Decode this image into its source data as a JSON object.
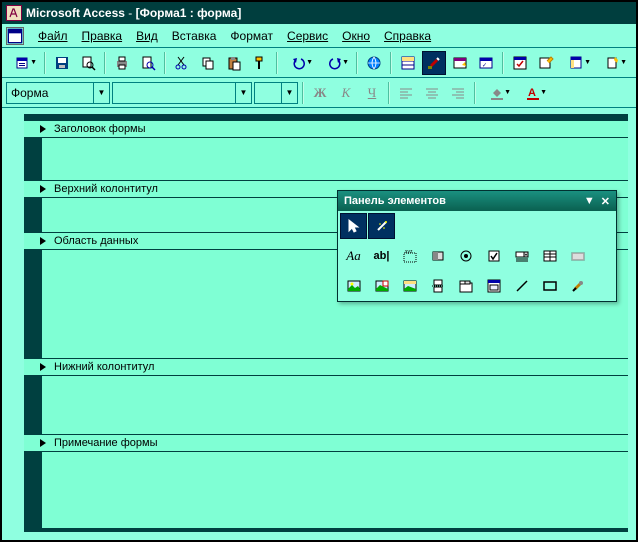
{
  "title": {
    "app": "Microsoft Access",
    "doc": "[Форма1 : форма]"
  },
  "menu": [
    "Файл",
    "Правка",
    "Вид",
    "Вставка",
    "Формат",
    "Сервис",
    "Окно",
    "Справка"
  ],
  "menu_accel": [
    0,
    0,
    0,
    1,
    3,
    0,
    0,
    0
  ],
  "format": {
    "object": "Форма",
    "bold": "Ж",
    "italic": "К",
    "underline": "Ч"
  },
  "sections": [
    "Заголовок формы",
    "Верхний колонтитул",
    "Область данных",
    "Нижний колонтитул",
    "Примечание формы"
  ],
  "toolbox": {
    "title": "Панель элементов"
  },
  "icons": {
    "view": "view-icon",
    "save": "save-icon",
    "search": "search-icon",
    "print": "print-icon",
    "preview": "preview-icon",
    "cut": "cut-icon",
    "copy": "copy-icon",
    "paste": "paste-icon",
    "format-painter": "format-painter-icon",
    "undo": "undo-icon",
    "redo": "redo-icon",
    "hyperlink": "hyperlink-icon",
    "field-list": "field-list-icon",
    "toolbox": "toolbox-icon",
    "autoformat": "autoformat-icon",
    "code": "code-icon",
    "properties": "properties-icon",
    "build": "build-icon",
    "dbwindow": "dbwindow-icon",
    "newobj": "newobj-icon",
    "help": "help-icon",
    "pointer": "pointer-icon",
    "wizard": "wizard-icon",
    "label": "label-icon",
    "textbox": "textbox-icon",
    "group": "group-icon",
    "toggle": "toggle-icon",
    "option": "option-icon",
    "check": "check-icon",
    "combo": "combo-icon",
    "list": "list-icon",
    "button": "button-icon",
    "image": "image-icon",
    "unbound": "unbound-icon",
    "bound": "bound-icon",
    "pagebreak": "pagebreak-icon",
    "tab": "tab-icon",
    "subform": "subform-icon",
    "line": "line-icon",
    "rect": "rect-icon",
    "more": "more-icon"
  }
}
